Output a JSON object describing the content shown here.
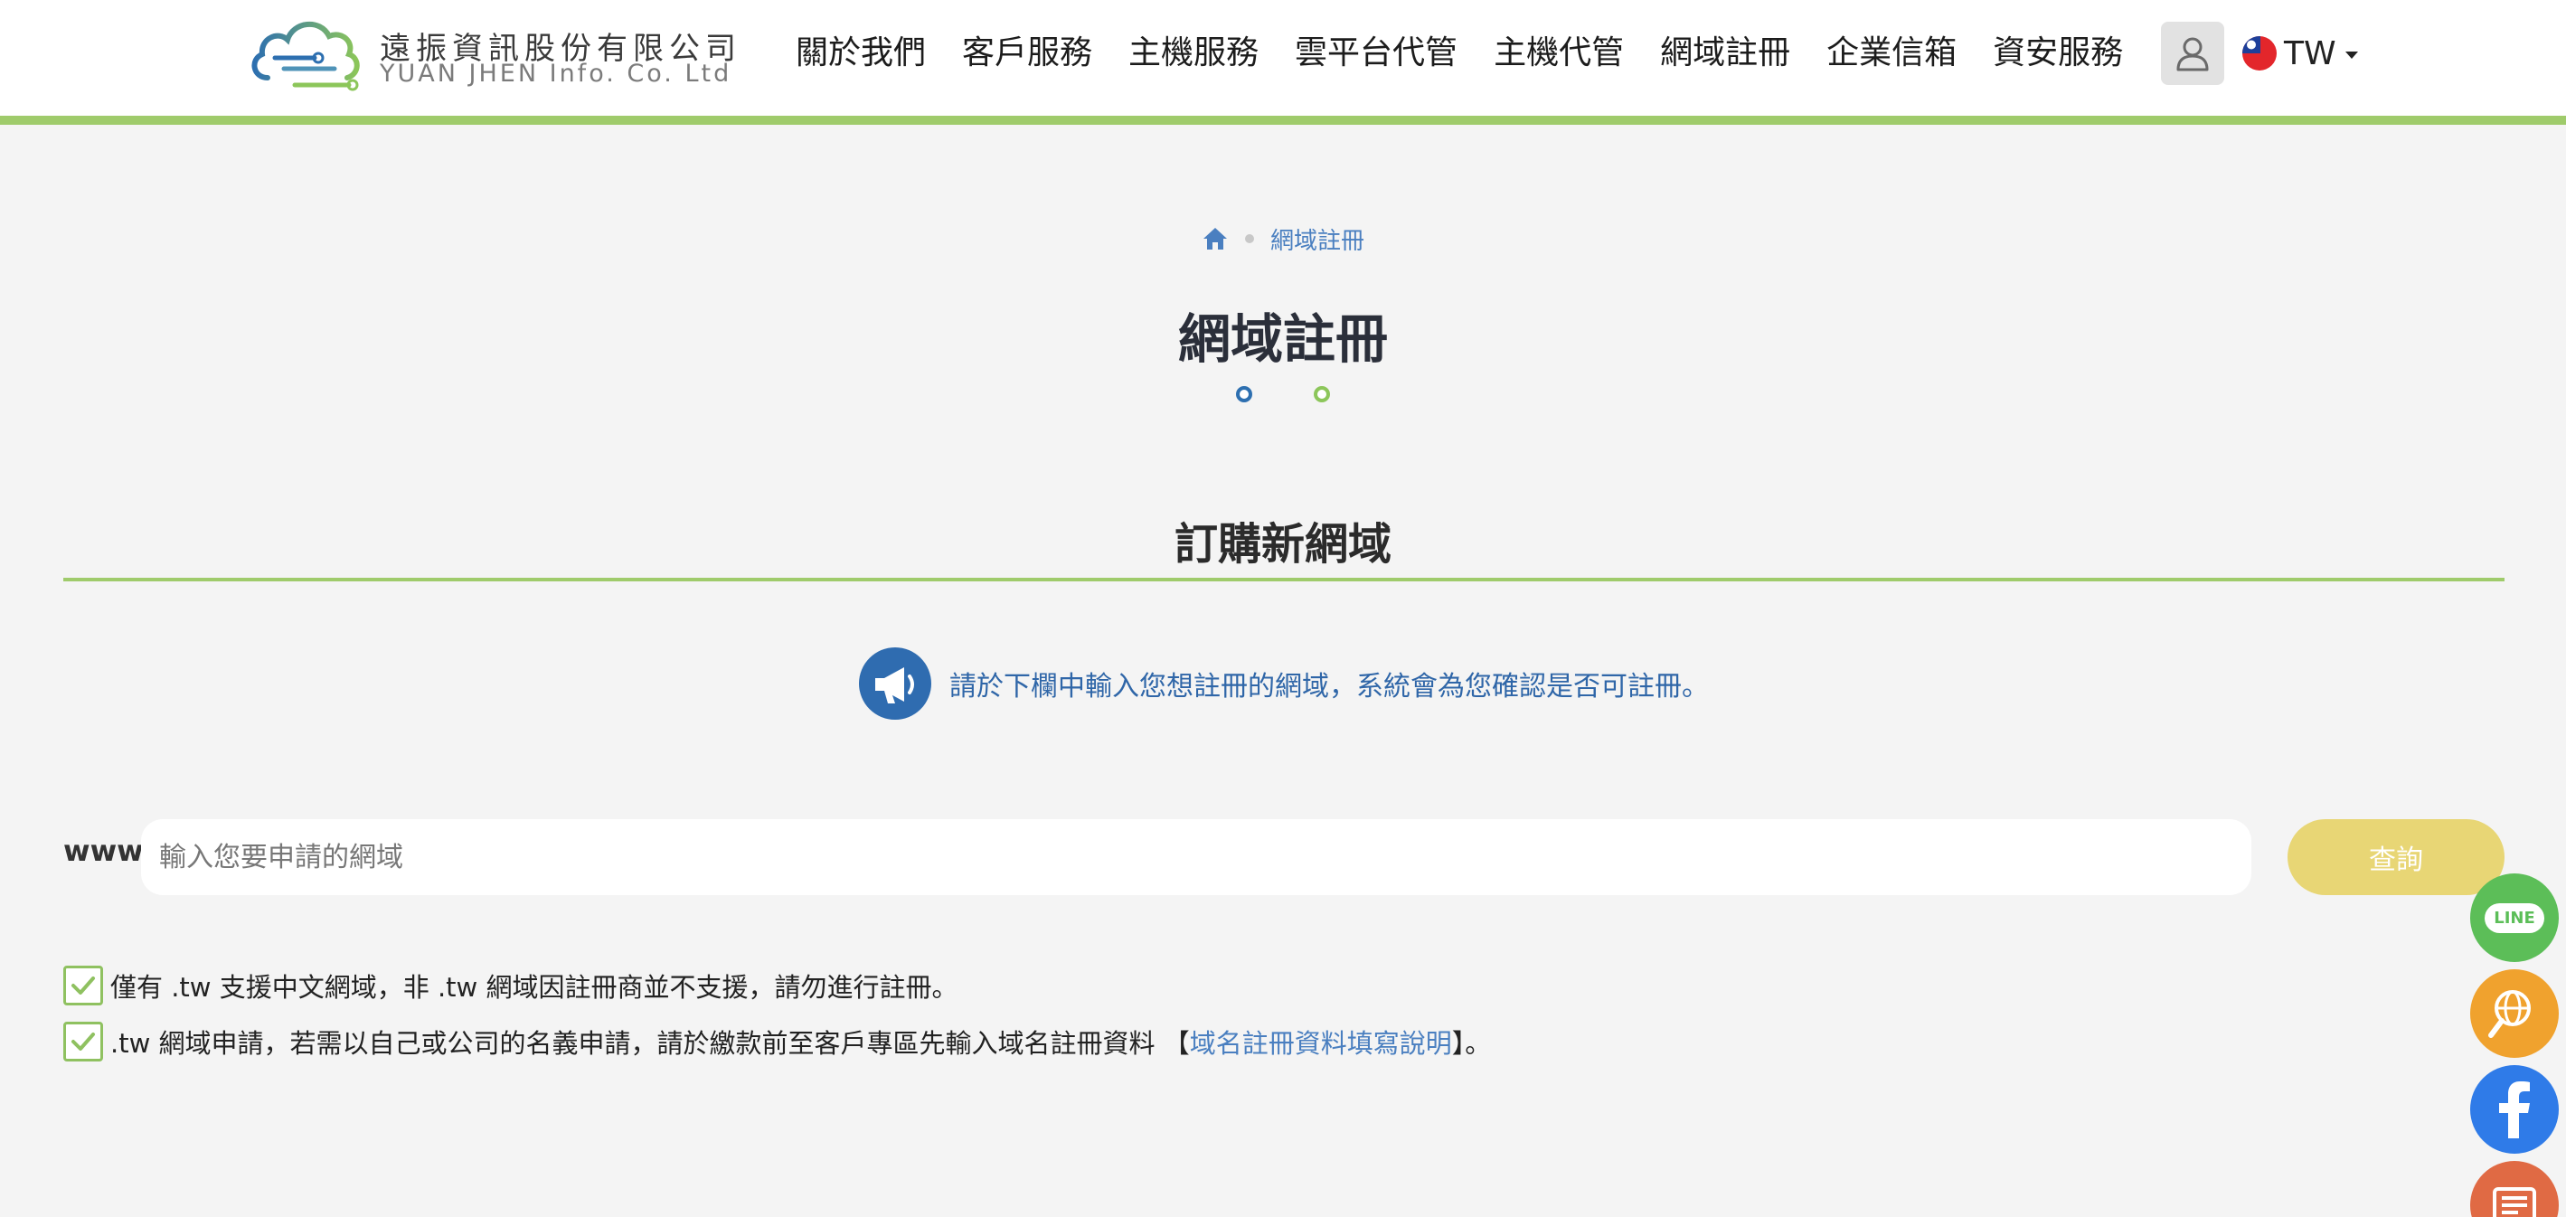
{
  "brand": {
    "name_cn": "遠振資訊股份有限公司",
    "name_en": "YUAN JHEN Info. Co. Ltd"
  },
  "nav": {
    "items": [
      {
        "label": "關於我們"
      },
      {
        "label": "客戶服務"
      },
      {
        "label": "主機服務"
      },
      {
        "label": "雲平台代管"
      },
      {
        "label": "主機代管"
      },
      {
        "label": "網域註冊"
      },
      {
        "label": "企業信箱"
      },
      {
        "label": "資安服務"
      }
    ],
    "language": "TW"
  },
  "breadcrumb": {
    "current": "網域註冊"
  },
  "page": {
    "title": "網域註冊",
    "section_title": "訂購新網域",
    "notice": "請於下欄中輸入您想註冊的網域，系統會為您確認是否可註冊。"
  },
  "search": {
    "prefix": "www.",
    "placeholder": "輸入您要申請的網域",
    "value": "",
    "button_label": "查詢"
  },
  "notes": {
    "note1": "僅有 .tw 支援中文網域，非 .tw 網域因註冊商並不支援，請勿進行註冊。",
    "note2_before": ".tw 網域申請，若需以自己或公司的名義申請，請於繳款前至客戶專區先輸入域名註冊資料 【",
    "note2_link": "域名註冊資料填寫說明",
    "note2_after": "】。"
  },
  "floating": {
    "line_label": "LINE"
  },
  "colors": {
    "accent_green": "#9fcb6b",
    "link_blue": "#4a7fc0",
    "button_yellow": "#e8d675",
    "title_dark": "#2b2f3a"
  }
}
